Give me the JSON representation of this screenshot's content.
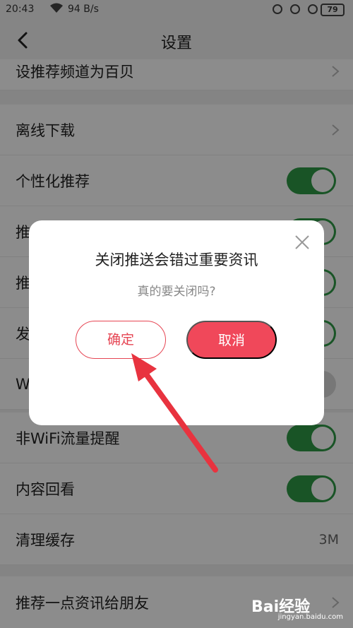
{
  "status_bar": {
    "time": "20:43",
    "net_speed": "94 B/s",
    "battery": "79"
  },
  "header": {
    "title": "设置"
  },
  "settings": {
    "set_home_channel": "设推荐频道为百贝",
    "offline_download": "离线下载",
    "personalized": {
      "label": "个性化推荐",
      "on": true
    },
    "push1": {
      "label": "推",
      "on": true
    },
    "push2": {
      "label": "推",
      "on": true
    },
    "push3": {
      "label": "发",
      "on": true
    },
    "wifi_row": {
      "label": "W",
      "on": false
    },
    "non_wifi_alert": {
      "label": "非WiFi流量提醒",
      "on": true
    },
    "content_review": {
      "label": "内容回看",
      "on": true
    },
    "clear_cache": {
      "label": "清理缓存",
      "value": "3M"
    },
    "recommend_friends": "推荐一点资讯给朋友"
  },
  "dialog": {
    "title": "关闭推送会错过重要资讯",
    "subtitle": "真的要关闭吗?",
    "confirm_label": "确定",
    "cancel_label": "取消"
  },
  "watermark": {
    "logo": "Bai经验",
    "url": "jingyan.baidu.com"
  },
  "colors": {
    "accent_red": "#f0485a",
    "toggle_green": "#2e9a45"
  }
}
